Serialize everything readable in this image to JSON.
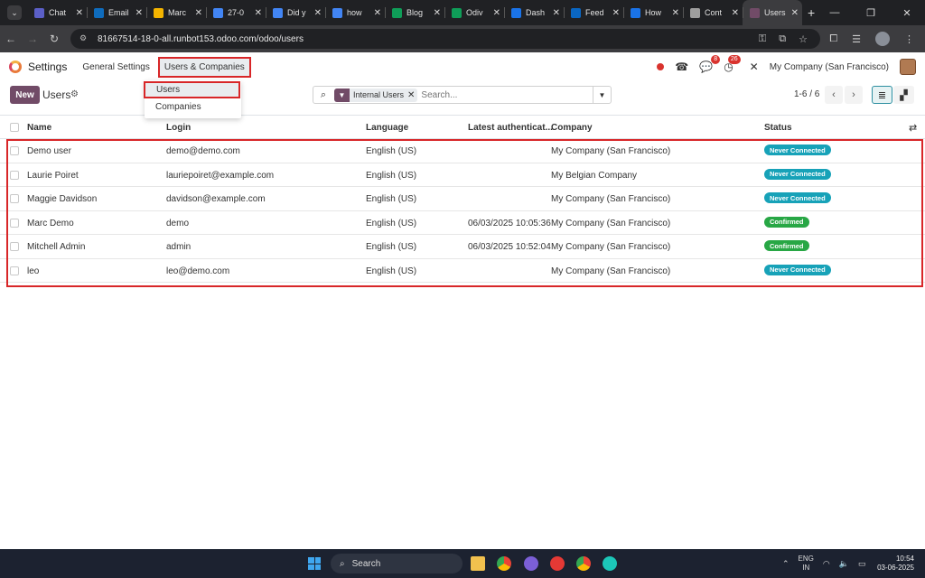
{
  "browser": {
    "tabs": [
      {
        "label": "Chat",
        "color": "#5b5fc7"
      },
      {
        "label": "Email",
        "color": "#0f6cbd"
      },
      {
        "label": "Marc",
        "color": "#f4b400"
      },
      {
        "label": "27-0",
        "color": "#4285f4"
      },
      {
        "label": "Did y",
        "color": "#4285f4"
      },
      {
        "label": "how",
        "color": "#4285f4"
      },
      {
        "label": "Blog",
        "color": "#0f9d58"
      },
      {
        "label": "Odiv",
        "color": "#0f9d58"
      },
      {
        "label": "Dash",
        "color": "#1a73e8"
      },
      {
        "label": "Feed",
        "color": "#0a66c2"
      },
      {
        "label": "How",
        "color": "#1a73e8"
      },
      {
        "label": "Cont",
        "color": "#9e9e9e"
      },
      {
        "label": "Users",
        "color": "#714b67",
        "active": true
      }
    ],
    "url": "81667514-18-0-all.runbot153.odoo.com/odoo/users"
  },
  "navbar": {
    "app_name": "Settings",
    "menu_general": "General Settings",
    "menu_users_companies": "Users & Companies",
    "messages_count": "8",
    "activities_count": "26",
    "company": "My Company (San Francisco)"
  },
  "dropdown": {
    "items": [
      "Users",
      "Companies"
    ]
  },
  "control_panel": {
    "new_label": "New",
    "title": "Users",
    "facet_label": "Internal Users",
    "search_placeholder": "Search...",
    "pager": "1-6 / 6"
  },
  "table": {
    "headers": {
      "name": "Name",
      "login": "Login",
      "language": "Language",
      "latest": "Latest authenticat...",
      "company": "Company",
      "status": "Status"
    },
    "rows": [
      {
        "name": "Demo user",
        "login": "demo@demo.com",
        "language": "English (US)",
        "latest": "",
        "company": "My Company (San Francisco)",
        "status": "Never Connected"
      },
      {
        "name": "Laurie Poiret",
        "login": "lauriepoiret@example.com",
        "language": "English (US)",
        "latest": "",
        "company": "My Belgian Company",
        "status": "Never Connected"
      },
      {
        "name": "Maggie Davidson",
        "login": "davidson@example.com",
        "language": "English (US)",
        "latest": "",
        "company": "My Company (San Francisco)",
        "status": "Never Connected"
      },
      {
        "name": "Marc Demo",
        "login": "demo",
        "language": "English (US)",
        "latest": "06/03/2025 10:05:36",
        "company": "My Company (San Francisco)",
        "status": "Confirmed"
      },
      {
        "name": "Mitchell Admin",
        "login": "admin",
        "language": "English (US)",
        "latest": "06/03/2025 10:52:04",
        "company": "My Company (San Francisco)",
        "status": "Confirmed"
      },
      {
        "name": "leo",
        "login": "leo@demo.com",
        "language": "English (US)",
        "latest": "",
        "company": "My Company (San Francisco)",
        "status": "Never Connected"
      }
    ],
    "status_colors": {
      "Never Connected": "#17a2b8",
      "Confirmed": "#28a745"
    }
  },
  "taskbar": {
    "search_label": "Search",
    "lang_top": "ENG",
    "lang_bottom": "IN",
    "time": "10:54",
    "date": "03-06-2025"
  }
}
